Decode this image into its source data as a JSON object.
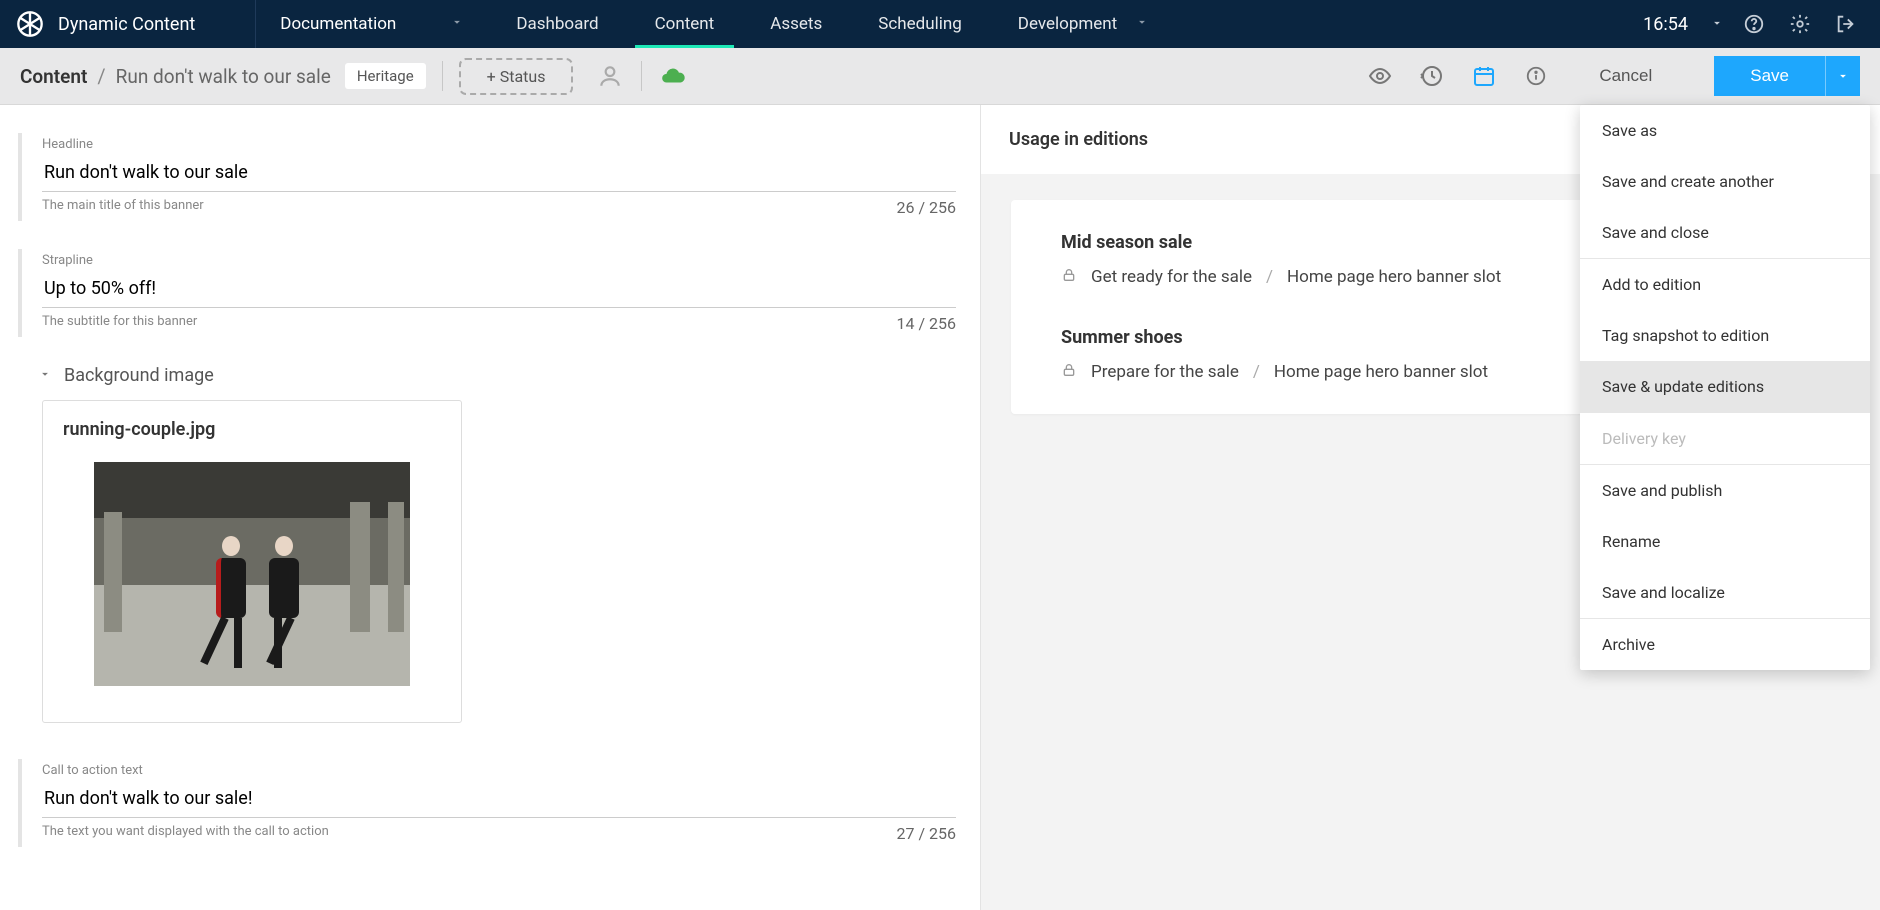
{
  "header": {
    "brand": "Dynamic Content",
    "docs": "Documentation",
    "tabs": [
      "Dashboard",
      "Content",
      "Assets",
      "Scheduling",
      "Development"
    ],
    "active_tab": "Content",
    "clock": "16:54"
  },
  "subbar": {
    "breadcrumb_root": "Content",
    "breadcrumb_leaf": "Run don't walk to our sale",
    "tag": "Heritage",
    "status_label": "+ Status",
    "cancel": "Cancel",
    "save": "Save"
  },
  "fields": {
    "headline": {
      "label": "Headline",
      "value": "Run don't walk to our sale",
      "help": "The main title of this banner",
      "count": "26 / 256"
    },
    "strapline": {
      "label": "Strapline",
      "value": "Up to 50% off!",
      "help": "The subtitle for this banner",
      "count": "14 / 256"
    },
    "bg_image": {
      "section": "Background image",
      "filename": "running-couple.jpg"
    },
    "cta": {
      "label": "Call to action text",
      "value": "Run don't walk to our sale!",
      "help": "The text you want displayed with the call to action",
      "count": "27 / 256"
    }
  },
  "right": {
    "title": "Usage in editions",
    "editions": [
      {
        "title": "Mid season sale",
        "path1": "Get ready for the sale",
        "path2": "Home page hero banner slot"
      },
      {
        "title": "Summer shoes",
        "path1": "Prepare for the sale",
        "path2": "Home page hero banner slot"
      }
    ]
  },
  "dropdown": [
    {
      "label": "Save as",
      "highlight": false
    },
    {
      "label": "Save and create another",
      "highlight": false
    },
    {
      "label": "Save and close",
      "highlight": false
    },
    {
      "sep": true
    },
    {
      "label": "Add to edition",
      "highlight": false
    },
    {
      "label": "Tag snapshot to edition",
      "highlight": false
    },
    {
      "label": "Save & update editions",
      "highlight": true
    },
    {
      "sep": true
    },
    {
      "label": "Delivery key",
      "disabled": true
    },
    {
      "sep": true
    },
    {
      "label": "Save and publish",
      "highlight": false
    },
    {
      "label": "Rename",
      "highlight": false
    },
    {
      "label": "Save and localize",
      "highlight": false
    },
    {
      "sep": true
    },
    {
      "label": "Archive",
      "highlight": false
    }
  ]
}
